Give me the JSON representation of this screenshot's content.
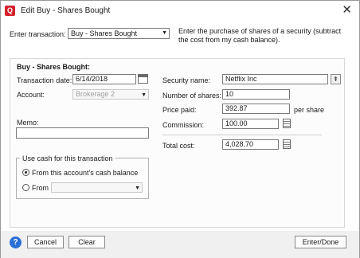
{
  "window": {
    "title": "Edit Buy - Shares Bought",
    "app_icon": "Q",
    "close_glyph": "✕"
  },
  "header": {
    "enter_transaction_label": "Enter transaction:",
    "transaction_type": "Buy - Shares Bought",
    "description": "Enter the purchase of shares of a security (subtract the cost from my cash balance)."
  },
  "section": {
    "heading": "Buy - Shares Bought:"
  },
  "form": {
    "transaction_date_label": "Transaction date:",
    "transaction_date": "6/14/2018",
    "account_label": "Account:",
    "account_value": "Brokerage 2",
    "memo_label": "Memo:",
    "memo_value": "",
    "security_name_label": "Security name:",
    "security_name": "Netflix Inc",
    "number_of_shares_label": "Number of shares:",
    "number_of_shares": "10",
    "price_paid_label": "Price paid:",
    "price_paid": "392.87",
    "per_share_label": "per share",
    "commission_label": "Commission:",
    "commission": "100.00",
    "total_cost_label": "Total cost:",
    "total_cost": "4,028.70"
  },
  "cash_group": {
    "legend": "Use cash for this transaction",
    "option_own": "From this account's cash balance",
    "option_from": "From",
    "from_account": ""
  },
  "footer": {
    "help_glyph": "?",
    "cancel": "Cancel",
    "clear": "Clear",
    "enter_done": "Enter/Done"
  },
  "colors": {
    "accent": "#2b6fd6",
    "brand": "#d6202c"
  }
}
